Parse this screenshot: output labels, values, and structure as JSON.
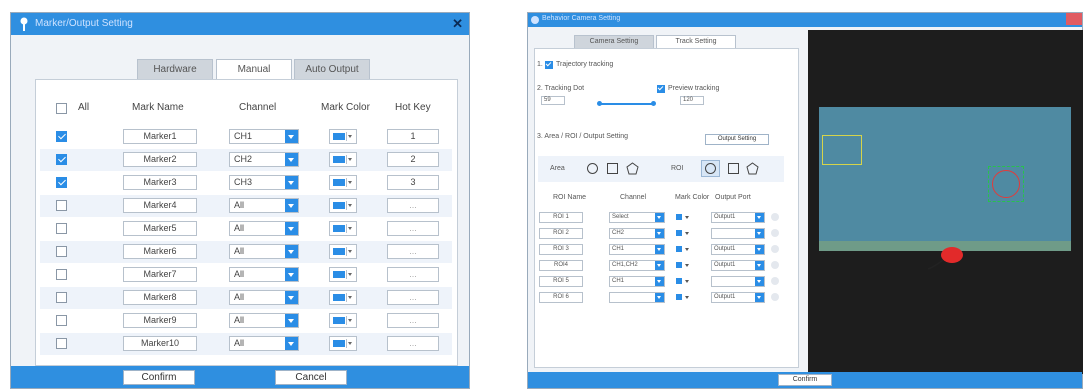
{
  "left_dialog": {
    "title": "Marker/Output Setting",
    "tabs": [
      {
        "label": "Hardware",
        "active": false
      },
      {
        "label": "Manual",
        "active": true
      },
      {
        "label": "Auto Output",
        "active": false
      }
    ],
    "headers": {
      "all": "All",
      "name": "Mark Name",
      "channel": "Channel",
      "color": "Mark Color",
      "hotkey": "Hot Key"
    },
    "rows": [
      {
        "checked": true,
        "name": "Marker1",
        "channel": "CH1",
        "hotkey": "1"
      },
      {
        "checked": true,
        "name": "Marker2",
        "channel": "CH2",
        "hotkey": "2"
      },
      {
        "checked": true,
        "name": "Marker3",
        "channel": "CH3",
        "hotkey": "3"
      },
      {
        "checked": false,
        "name": "Marker4",
        "channel": "All",
        "hotkey": "..."
      },
      {
        "checked": false,
        "name": "Marker5",
        "channel": "All",
        "hotkey": "..."
      },
      {
        "checked": false,
        "name": "Marker6",
        "channel": "All",
        "hotkey": "..."
      },
      {
        "checked": false,
        "name": "Marker7",
        "channel": "All",
        "hotkey": "..."
      },
      {
        "checked": false,
        "name": "Marker8",
        "channel": "All",
        "hotkey": "..."
      },
      {
        "checked": false,
        "name": "Marker9",
        "channel": "All",
        "hotkey": "..."
      },
      {
        "checked": false,
        "name": "Marker10",
        "channel": "All",
        "hotkey": "..."
      }
    ],
    "confirm_label": "Confirm",
    "cancel_label": "Cancel",
    "accent": "#2f8fe0"
  },
  "right_dialog": {
    "title": "Behavior Camera Setting",
    "tabs": [
      {
        "label": "Camera Setting",
        "active": false
      },
      {
        "label": "Track Setting",
        "active": true
      }
    ],
    "trajectory_label": "Trajectory tracking",
    "tracking_dot_label": "2. Tracking Dot",
    "tracking_dot_value": "59",
    "preview_label": "Preview tracking",
    "preview_value": "120",
    "section3_label": "3. Area / ROI / Output Setting",
    "output_setting_label": "Output Setting",
    "area_label": "Area",
    "roi_label": "ROI",
    "roi_headers": {
      "name": "ROI Name",
      "channel": "Channel",
      "color": "Mark Color",
      "port": "Output Port"
    },
    "roi_rows": [
      {
        "name": "ROI 1",
        "channel": "Select",
        "port": "Output1"
      },
      {
        "name": "ROI 2",
        "channel": "CH2",
        "port": ""
      },
      {
        "name": "ROI 3",
        "channel": "CH1",
        "port": "Output1"
      },
      {
        "name": "ROI4",
        "channel": "CH1,CH2",
        "port": "Output1"
      },
      {
        "name": "ROI 5",
        "channel": "CH1",
        "port": ""
      },
      {
        "name": "ROI 6",
        "channel": "",
        "port": "Output1"
      }
    ],
    "confirm_label": "Confirm",
    "arena_color": "#4f8aa2"
  }
}
